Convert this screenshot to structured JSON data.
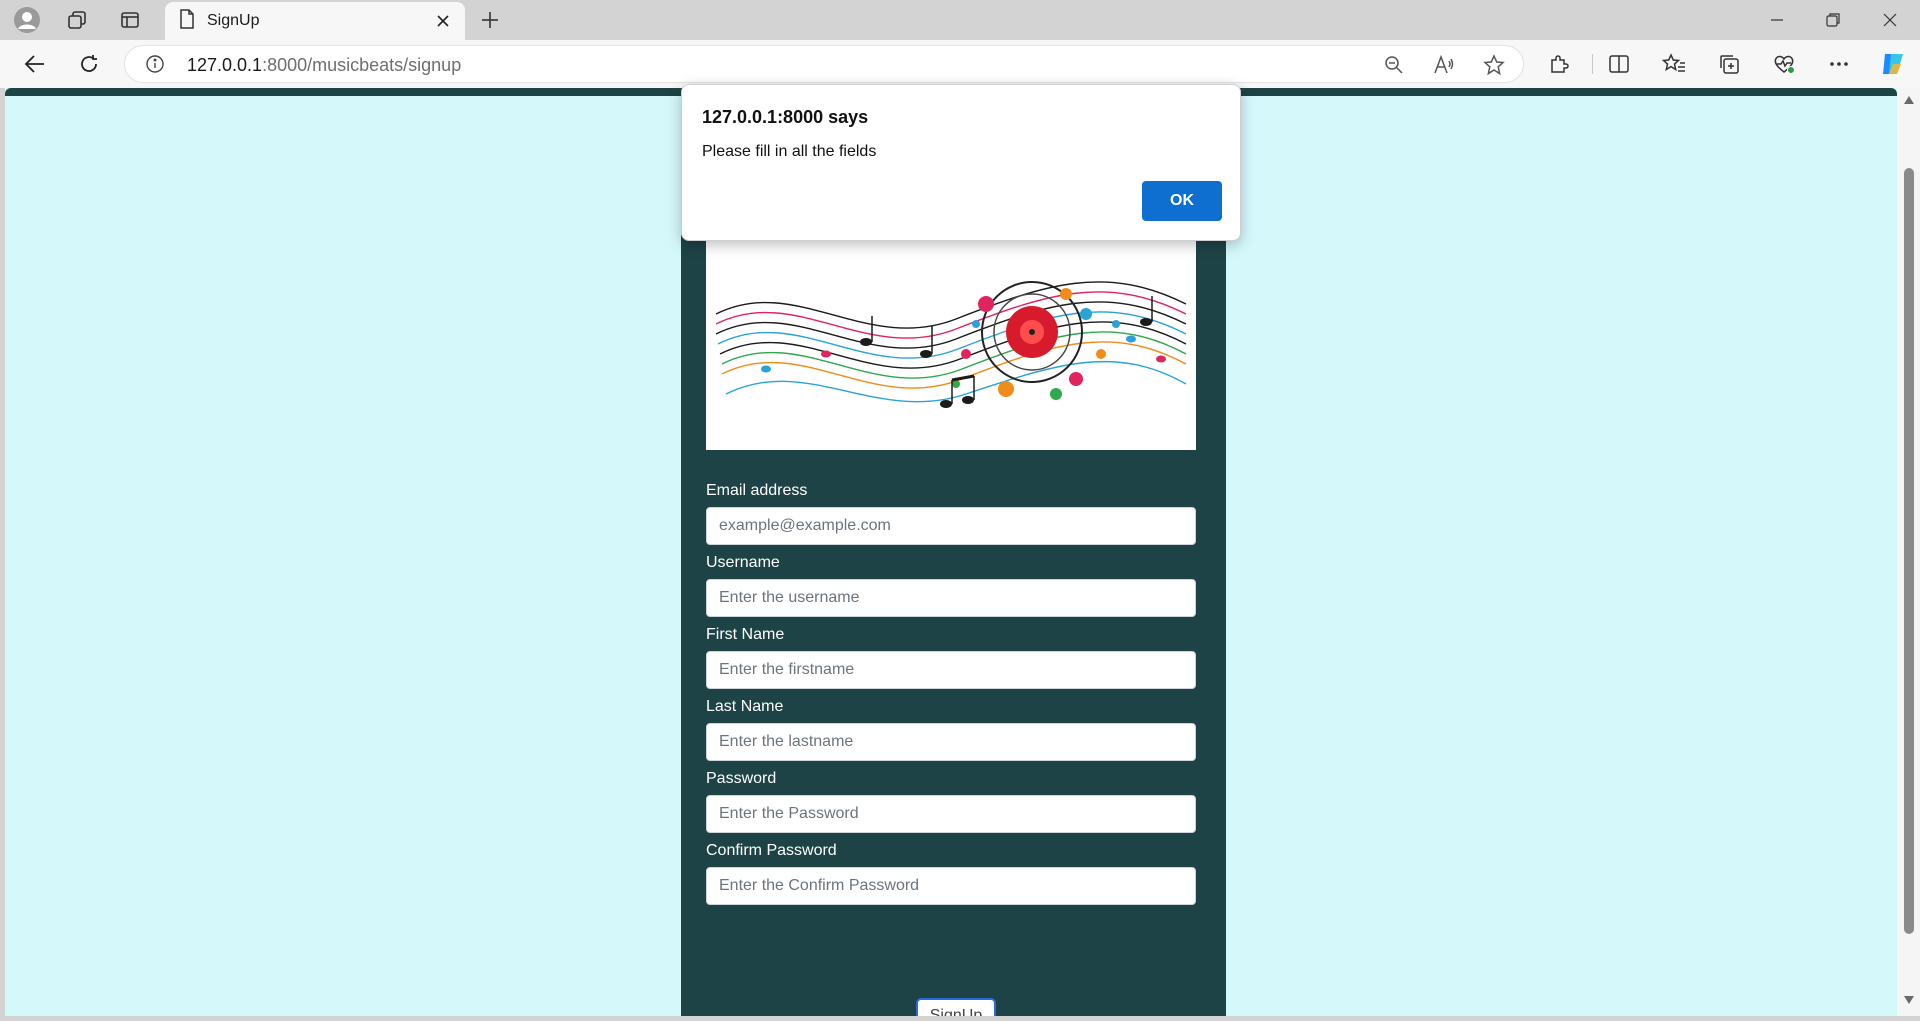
{
  "browser": {
    "tab": {
      "title": "SignUp"
    },
    "url": {
      "host": "127.0.0.1",
      "rest": ":8000/musicbeats/signup"
    }
  },
  "dialog": {
    "title": "127.0.0.1:8000 says",
    "message": "Please fill in all the fields",
    "ok_label": "OK"
  },
  "form": {
    "email": {
      "label": "Email address",
      "placeholder": "example@example.com"
    },
    "username": {
      "label": "Username",
      "placeholder": "Enter the username"
    },
    "firstname": {
      "label": "First Name",
      "placeholder": "Enter the firstname"
    },
    "lastname": {
      "label": "Last Name",
      "placeholder": "Enter the lastname"
    },
    "password": {
      "label": "Password",
      "placeholder": "Enter the Password"
    },
    "confirm": {
      "label": "Confirm Password",
      "placeholder": "Enter the Confirm Password"
    },
    "submit_label": "SignUp"
  },
  "colors": {
    "page_background": "#d5f9fb",
    "panel": "#1e4347",
    "dialog_button": "#0f6fd0"
  }
}
